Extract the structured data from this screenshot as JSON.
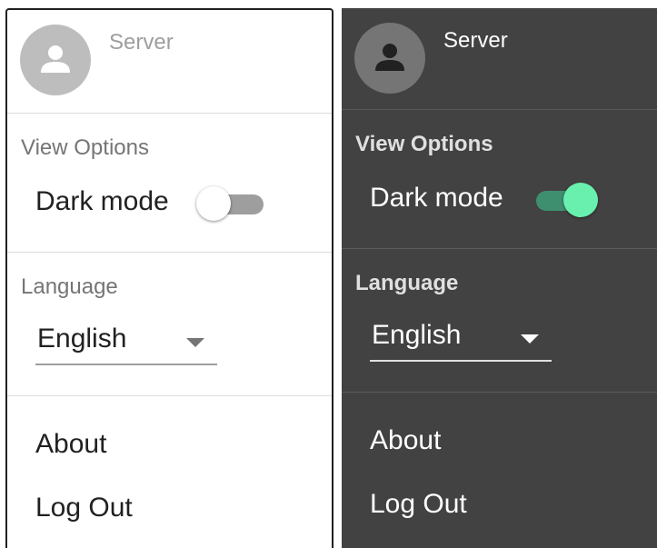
{
  "panels": {
    "light": {
      "server_name": "Server",
      "view_options_title": "View Options",
      "dark_mode_label": "Dark mode",
      "dark_mode_on": false,
      "language_title": "Language",
      "language_value": "English",
      "about_label": "About",
      "logout_label": "Log Out"
    },
    "dark": {
      "server_name": "Server",
      "view_options_title": "View Options",
      "dark_mode_label": "Dark mode",
      "dark_mode_on": true,
      "language_title": "Language",
      "language_value": "English",
      "about_label": "About",
      "logout_label": "Log Out"
    }
  },
  "colors": {
    "accent_thumb": "#69f0ae",
    "accent_track": "#3e8f70",
    "dark_background": "#424242",
    "light_background": "#ffffff"
  },
  "icons": {
    "avatar": "person-icon",
    "dropdown": "caret-down-icon"
  }
}
